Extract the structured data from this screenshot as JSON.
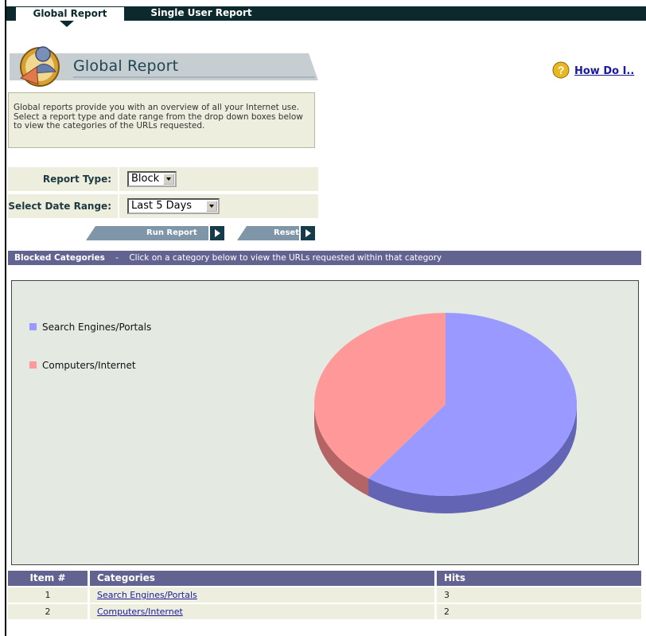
{
  "tabs": [
    {
      "label": "Global Report",
      "active": true
    },
    {
      "label": "Single User Report",
      "active": false
    }
  ],
  "header": {
    "title": "Global Report",
    "help_link": "How Do I.."
  },
  "description": "Global reports provide you with an overview of all your Internet use. Select a report type and date range from the drop down boxes below to view the categories of the URLs requested.",
  "form": {
    "report_type_label": "Report Type:",
    "report_type_value": "Block",
    "date_range_label": "Select Date Range:",
    "date_range_value": "Last 5 Days"
  },
  "buttons": {
    "run_report": "Run Report",
    "reset": "Reset"
  },
  "category_bar": {
    "title": "Blocked Categories",
    "separator": "-",
    "hint": "Click on a category below to view the URLs requested within that category"
  },
  "colors": {
    "search_engines": "#9999ff",
    "computers_internet": "#ff9999",
    "header_bar": "#636391",
    "tab_bar": "#0c2a2e"
  },
  "chart_data": {
    "type": "pie",
    "categories": [
      "Search Engines/Portals",
      "Computers/Internet"
    ],
    "values": [
      3,
      2
    ],
    "legend": [
      "Search Engines/Portals",
      "Computers/Internet"
    ],
    "legend_position": "left"
  },
  "table": {
    "headers": [
      "Item #",
      "Categories",
      "Hits"
    ],
    "rows": [
      {
        "item": "1",
        "category": "Search Engines/Portals",
        "hits": "3"
      },
      {
        "item": "2",
        "category": "Computers/Internet",
        "hits": "2"
      }
    ]
  }
}
